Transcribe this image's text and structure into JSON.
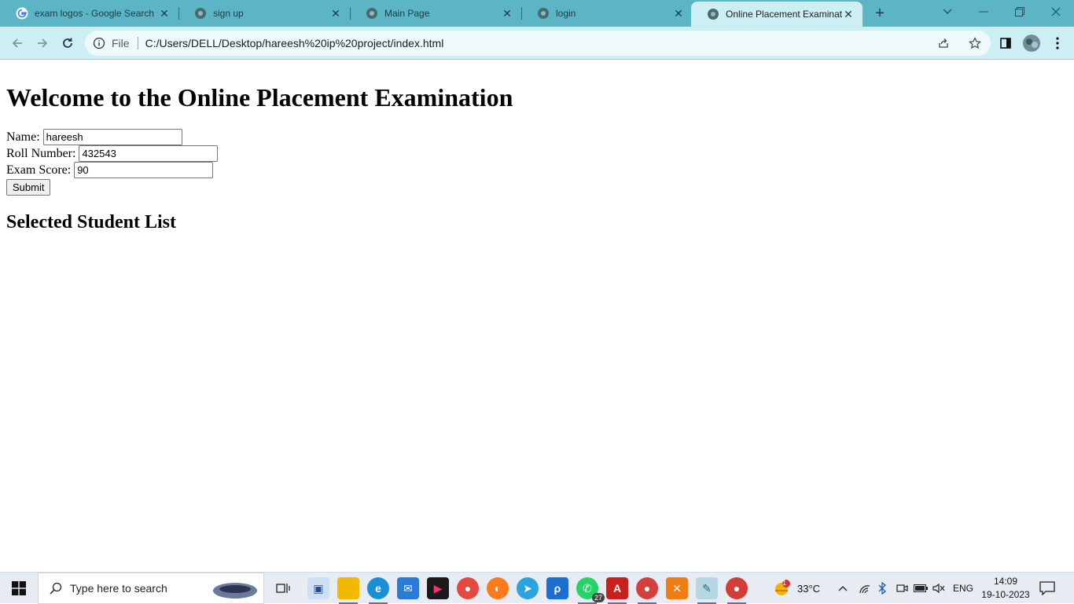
{
  "browser": {
    "tabs": [
      {
        "label": "exam logos - Google Search",
        "icon": "google-g-icon",
        "active": false
      },
      {
        "label": "sign up",
        "icon": "globe-icon",
        "active": false
      },
      {
        "label": "Main Page",
        "icon": "globe-icon",
        "active": false
      },
      {
        "label": "login",
        "icon": "globe-icon",
        "active": false
      },
      {
        "label": "Online Placement Examinati",
        "icon": "globe-icon",
        "active": true
      }
    ],
    "address": {
      "scheme_label": "File",
      "url": "C:/Users/DELL/Desktop/hareesh%20ip%20project/index.html"
    }
  },
  "page": {
    "heading": "Welcome to the Online Placement Examination",
    "form": {
      "name_label": "Name:",
      "name_value": "hareesh",
      "roll_label": "Roll Number:",
      "roll_value": "432543",
      "score_label": "Exam Score:",
      "score_value": "90",
      "submit_label": "Submit"
    },
    "list_heading": "Selected Student List"
  },
  "taskbar": {
    "search_placeholder": "Type here to search",
    "whatsapp_badge": "27",
    "weather_badge": "1",
    "temperature": "33°C",
    "language": "ENG",
    "time": "14:09",
    "date": "19-10-2023"
  },
  "colors": {
    "tabstrip": "#5bb5c5",
    "toolbar": "#cdeff3",
    "taskbar": "#e6ecf1"
  }
}
